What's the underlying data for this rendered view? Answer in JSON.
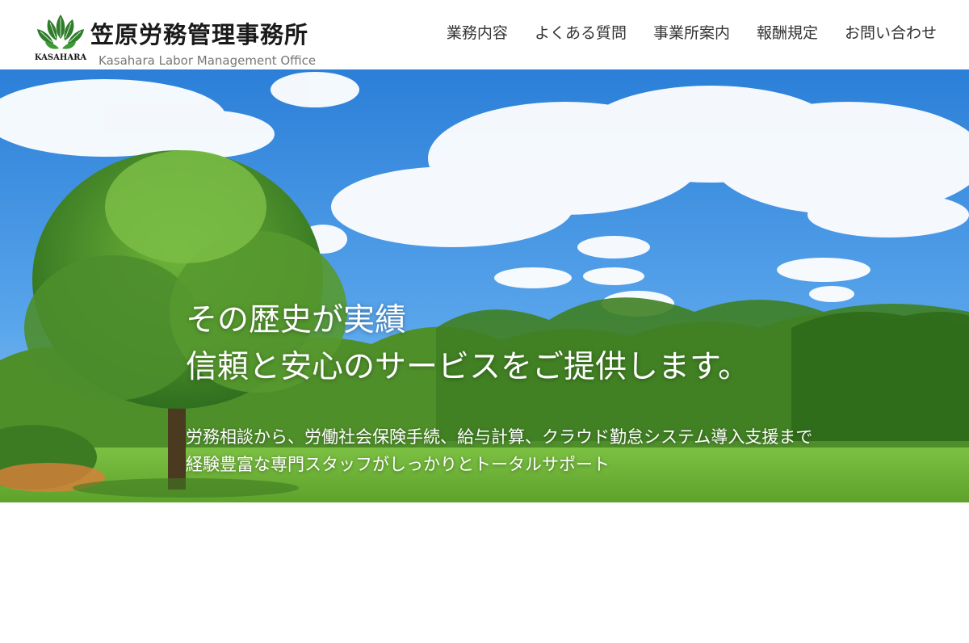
{
  "header": {
    "logo": {
      "title": "笠原労務管理事務所",
      "subtitle": "Kasahara Labor Management Office",
      "emblem_text": "KASAHARA",
      "emblem_icon": "leaf-emblem-icon",
      "brand_green": "#2f7d2b"
    },
    "nav": [
      {
        "label": "業務内容"
      },
      {
        "label": "よくある質問"
      },
      {
        "label": "事業所案内"
      },
      {
        "label": "報酬規定"
      },
      {
        "label": "お問い合わせ"
      }
    ]
  },
  "hero": {
    "headline": [
      "その歴史が実績",
      "信頼と安心のサービスをご提供します。"
    ],
    "subtext": [
      "労務相談から、労働社会保険手続、給与計算、クラウド勤怠システム導入支援まで",
      "経験豊富な専門スタッフがしっかりとトータルサポート"
    ],
    "sky_color": "#3d8fe0",
    "grass_color": "#6fb33a"
  }
}
